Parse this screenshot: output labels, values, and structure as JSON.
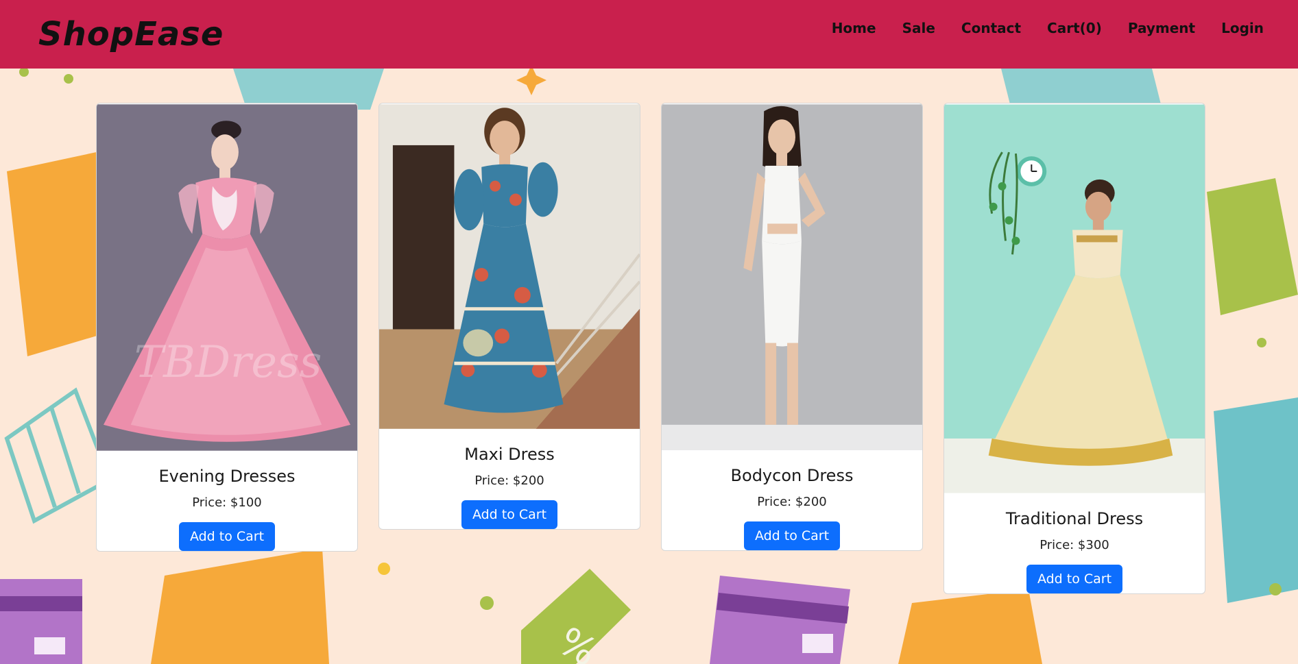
{
  "brand": "ShopEase",
  "nav": {
    "home": "Home",
    "sale": "Sale",
    "contact": "Contact",
    "cart": "Cart(0)",
    "payment": "Payment",
    "login": "Login"
  },
  "products": [
    {
      "name": "Evening Dresses",
      "price": "Price: $100",
      "button": "Add to Cart",
      "image_icon": "pink-ball-gown-photo"
    },
    {
      "name": "Maxi Dress",
      "price": "Price: $200",
      "button": "Add to Cart",
      "image_icon": "floral-maxi-dress-photo"
    },
    {
      "name": "Bodycon Dress",
      "price": "Price: $200",
      "button": "Add to Cart",
      "image_icon": "white-bodycon-dress-photo"
    },
    {
      "name": "Traditional Dress",
      "price": "Price: $300",
      "button": "Add to Cart",
      "image_icon": "traditional-gown-photo"
    }
  ],
  "watermark": "TBDress",
  "colors": {
    "header": "#c9204d",
    "background": "#fde8d8",
    "button": "#0d6efd"
  }
}
